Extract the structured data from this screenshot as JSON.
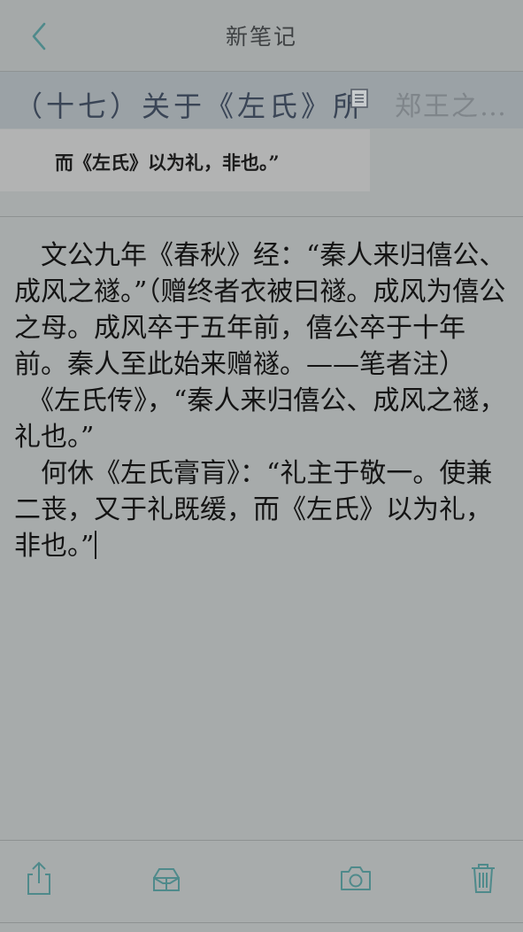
{
  "header": {
    "title": "新笔记",
    "back_icon": "chevron-left-icon"
  },
  "chapter_bar": {
    "current": "（十七）关于《左氏》所记",
    "next": "郑王之…",
    "note_icon": "note-icon"
  },
  "quote": {
    "text": "而《左氏》以为礼，非也。”"
  },
  "body": {
    "paragraphs": [
      "　文公九年《春秋》经：“秦人来归僖公、成风之禭。”（赠终者衣被曰禭。成风为僖公之母。成风卒于五年前，僖公卒于十年前。秦人至此始来赠禭。——笔者注）",
      "　《左氏传》，“秦人来归僖公、成风之禭，礼也。”",
      "　何休《左氏膏肓》：“礼主于敬一。使兼二丧，又于礼既缓，而《左氏》以为礼，非也。”"
    ]
  },
  "toolbar": {
    "share_icon": "share-icon",
    "archive_icon": "box-icon",
    "camera_icon": "camera-icon",
    "delete_icon": "trash-icon"
  },
  "colors": {
    "background": "#a7abab",
    "accent": "#4f8a8b",
    "chapter_bar": "#9ba2a6"
  }
}
